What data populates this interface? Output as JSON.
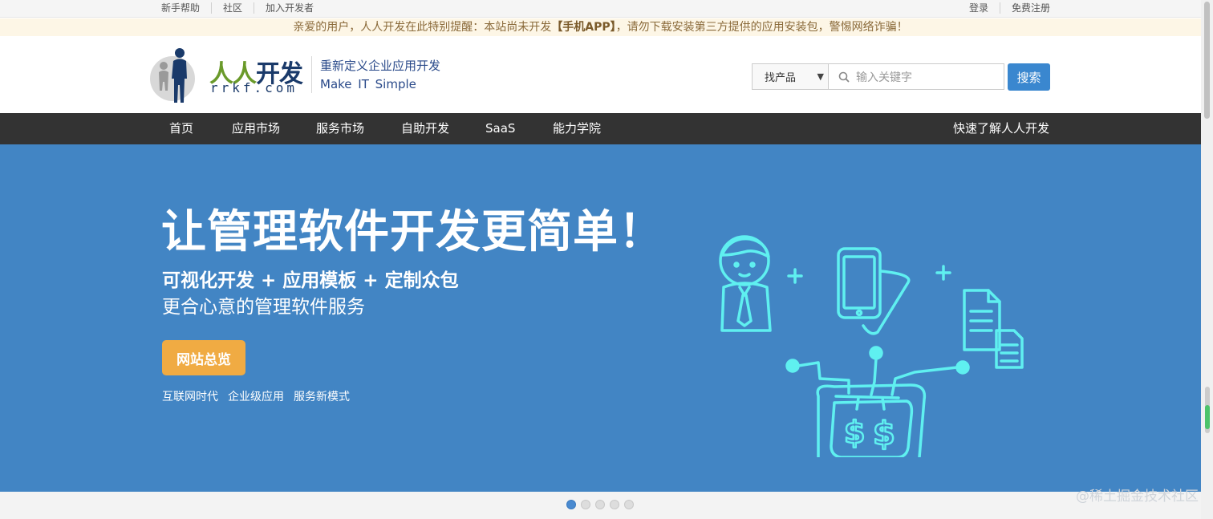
{
  "topbar": {
    "left_links": [
      "新手帮助",
      "社区",
      "加入开发者"
    ],
    "right_links": [
      "登录",
      "免费注册"
    ]
  },
  "notice": {
    "prefix": "亲爱的用户，人人开发在此特别提醒：本站尚未开发",
    "highlight": "【手机APP】",
    "suffix": "，请勿下载安装第三方提供的应用安装包，警惕网络诈骗！"
  },
  "header": {
    "logo_cn_a": "人人",
    "logo_cn_b": "开发",
    "logo_en": "rrkf.com",
    "slogan_cn": "重新定义企业应用开发",
    "slogan_en": "Make  IT  Simple",
    "search_select": "找产品",
    "search_placeholder": "输入关键字",
    "search_button": "搜索"
  },
  "nav": {
    "items": [
      "首页",
      "应用市场",
      "服务市场",
      "自助开发",
      "SaaS",
      "能力学院"
    ],
    "right_item": "快速了解人人开发"
  },
  "hero": {
    "title": "让管理软件开发更简单！",
    "sub1": "可视化开发 + 应用模板 + 定制众包",
    "sub2": "更合心意的管理软件服务",
    "button": "网站总览",
    "tags": [
      "互联网时代",
      "企业级应用",
      "服务新模式"
    ],
    "illustration_icons": [
      "person-icon",
      "phone-icon",
      "document-icon",
      "money-wallet-icon",
      "plus-icon"
    ]
  },
  "carousel": {
    "dot_count": 5,
    "active_index": 0
  },
  "watermark": "@稀土掘金技术社区",
  "colors": {
    "hero_bg": "#4285c4",
    "nav_bg": "#333333",
    "accent": "#3a87cf",
    "button_orange": "#f0ab43",
    "illustration": "#5ff0f0"
  }
}
